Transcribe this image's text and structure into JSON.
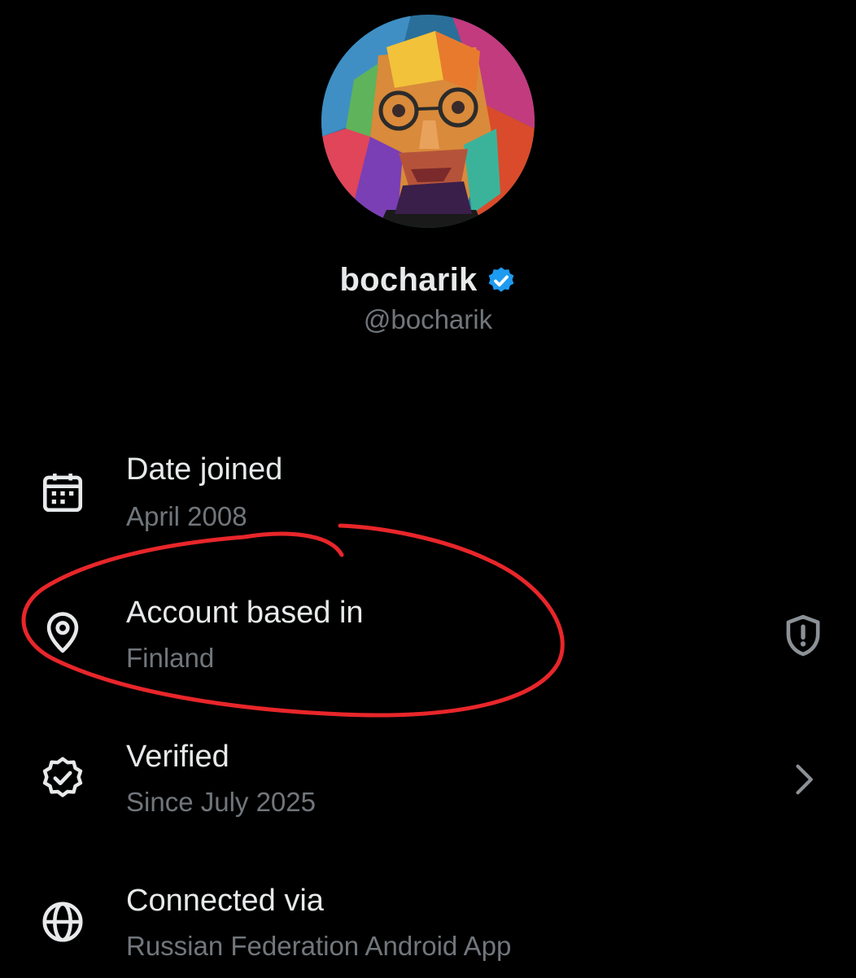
{
  "profile": {
    "display_name": "bocharik",
    "handle": "@bocharik",
    "verified_color": "#1d9bf0"
  },
  "rows": [
    {
      "icon": "calendar-icon",
      "title": "Date joined",
      "subtitle": "April 2008"
    },
    {
      "icon": "location-pin-icon",
      "title": "Account based in",
      "subtitle": "Finland",
      "trailing_icon": "shield-alert-icon"
    },
    {
      "icon": "verified-seal-icon",
      "title": "Verified",
      "subtitle": "Since July 2025",
      "trailing_icon": "chevron-right-icon"
    },
    {
      "icon": "globe-icon",
      "title": "Connected via",
      "subtitle": "Russian Federation Android App"
    }
  ],
  "colors": {
    "background": "#000000",
    "primary_text": "#e7e9ea",
    "secondary_text": "#71767b",
    "annotation": "#e8262a"
  }
}
